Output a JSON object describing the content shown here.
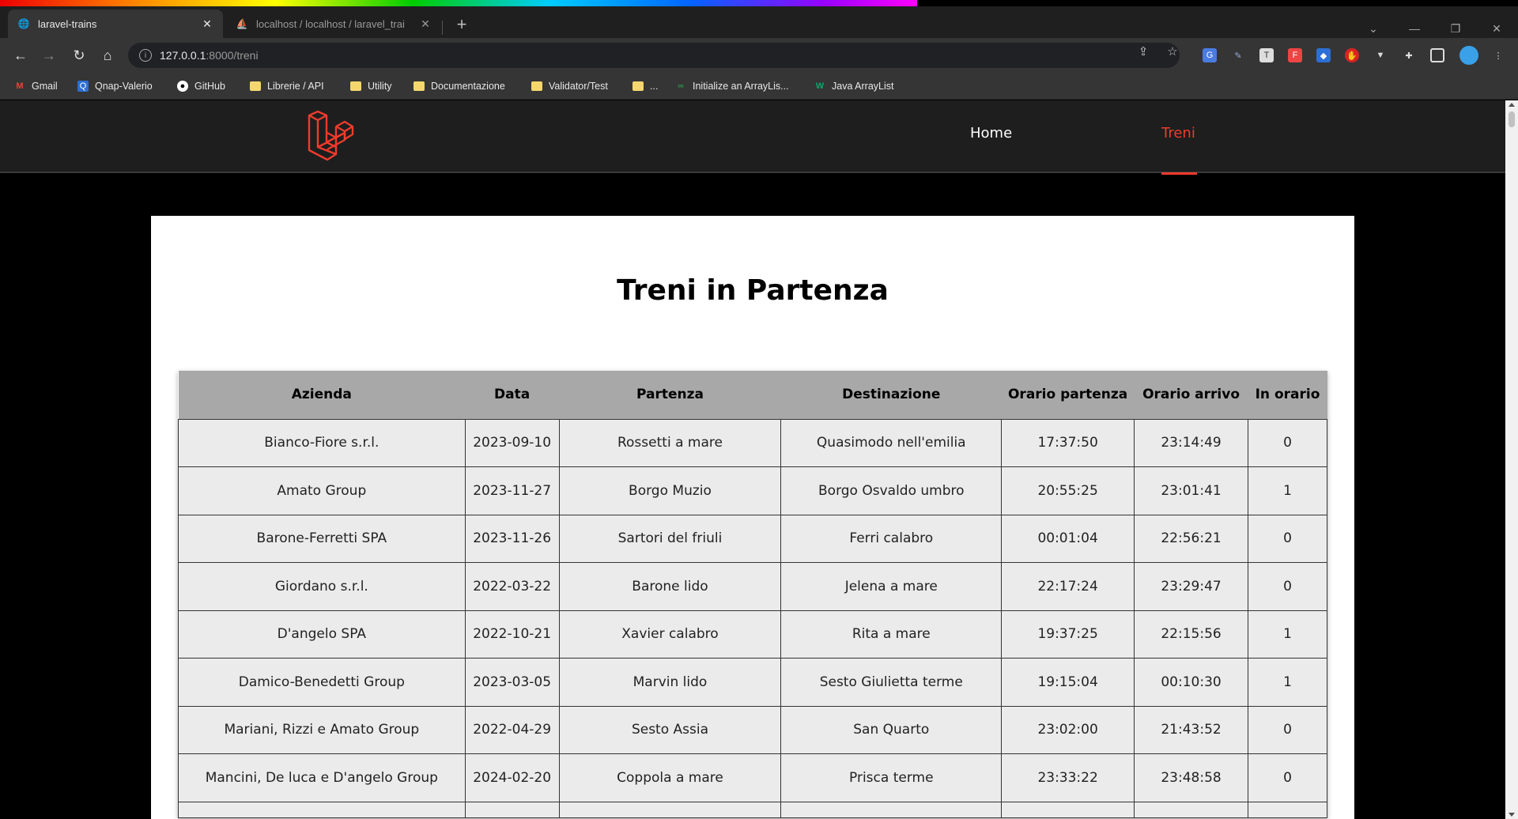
{
  "browser": {
    "tabs": [
      {
        "title": "laravel-trains",
        "active": true
      },
      {
        "title": "localhost / localhost / laravel_trai",
        "active": false
      }
    ],
    "url_host": "127.0.0.1",
    "url_path": ":8000/treni",
    "bookmarks": [
      "Gmail",
      "Qnap-Valerio",
      "GitHub",
      "Librerie / API",
      "Utility",
      "Documentazione",
      "Validator/Test",
      "...",
      "Initialize an ArrayLis...",
      "Java ArrayList"
    ]
  },
  "site": {
    "nav": {
      "home": "Home",
      "treni": "Treni"
    },
    "accent_color": "#ef3b2d"
  },
  "main": {
    "title": "Treni in Partenza",
    "columns": [
      "Azienda",
      "Data",
      "Partenza",
      "Destinazione",
      "Orario partenza",
      "Orario arrivo",
      "In orario"
    ],
    "rows": [
      [
        "Bianco-Fiore s.r.l.",
        "2023-09-10",
        "Rossetti a mare",
        "Quasimodo nell'emilia",
        "17:37:50",
        "23:14:49",
        "0"
      ],
      [
        "Amato Group",
        "2023-11-27",
        "Borgo Muzio",
        "Borgo Osvaldo umbro",
        "20:55:25",
        "23:01:41",
        "1"
      ],
      [
        "Barone-Ferretti SPA",
        "2023-11-26",
        "Sartori del friuli",
        "Ferri calabro",
        "00:01:04",
        "22:56:21",
        "0"
      ],
      [
        "Giordano s.r.l.",
        "2022-03-22",
        "Barone lido",
        "Jelena a mare",
        "22:17:24",
        "23:29:47",
        "0"
      ],
      [
        "D'angelo SPA",
        "2022-10-21",
        "Xavier calabro",
        "Rita a mare",
        "19:37:25",
        "22:15:56",
        "1"
      ],
      [
        "Damico-Benedetti Group",
        "2023-03-05",
        "Marvin lido",
        "Sesto Giulietta terme",
        "19:15:04",
        "00:10:30",
        "1"
      ],
      [
        "Mariani, Rizzi e Amato Group",
        "2022-04-29",
        "Sesto Assia",
        "San Quarto",
        "23:02:00",
        "21:43:52",
        "0"
      ],
      [
        "Mancini, De luca e D'angelo Group",
        "2024-02-20",
        "Coppola a mare",
        "Prisca terme",
        "23:33:22",
        "23:48:58",
        "0"
      ]
    ]
  }
}
